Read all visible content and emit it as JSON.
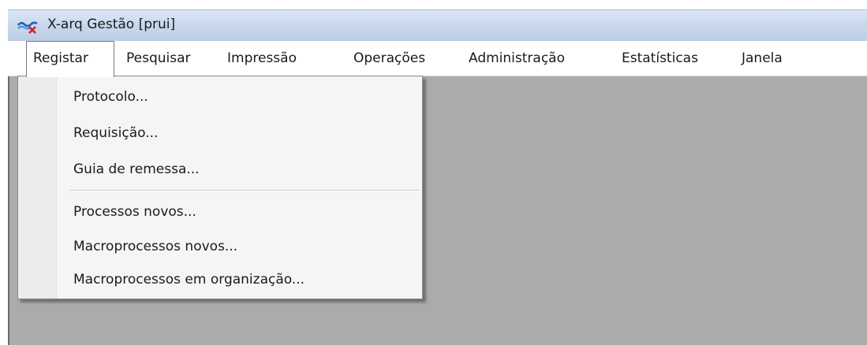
{
  "window": {
    "title": "X-arq Gestão [prui]",
    "icon": "x-arq-app-icon"
  },
  "menubar": {
    "items": [
      {
        "label": "Registar",
        "open": true
      },
      {
        "label": "Pesquisar"
      },
      {
        "label": "Impressão"
      },
      {
        "label": "Operações"
      },
      {
        "label": "Administração"
      },
      {
        "label": "Estatísticas"
      },
      {
        "label": "Janela"
      }
    ]
  },
  "dropdown": {
    "items": [
      {
        "label": "Protocolo..."
      },
      {
        "label": "Requisição..."
      },
      {
        "label": "Guia de remessa..."
      },
      {
        "label": "Processos novos..."
      },
      {
        "label": "Macroprocessos novos..."
      },
      {
        "label": "Macroprocessos em organização..."
      }
    ]
  },
  "colors": {
    "client_area": "#ababab",
    "menu_background": "#f5f5f5",
    "titlebar": "#c6d6ea"
  }
}
